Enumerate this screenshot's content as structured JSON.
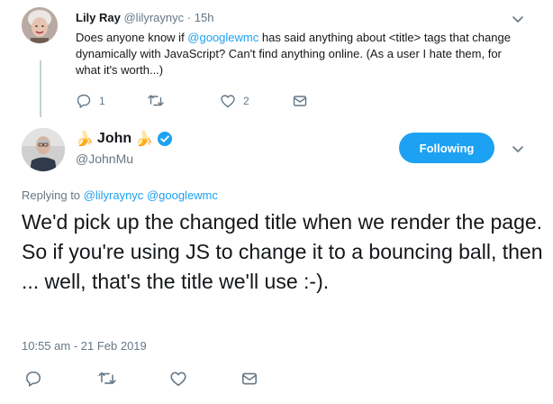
{
  "parent_tweet": {
    "name": "Lily Ray",
    "handle": "@lilyraynyc",
    "separator": "·",
    "time": "15h",
    "body_before_mention": "Does anyone know if ",
    "mention": "@googlewmc",
    "body_after_mention": " has said anything about <title> tags that change dynamically with JavaScript? Can't find anything online. (As a user I hate them, for what it's worth...)",
    "actions": {
      "reply_count": "1",
      "like_count": "2"
    }
  },
  "main_tweet": {
    "name": "John",
    "name_emoji": "🍌",
    "handle": "@JohnMu",
    "follow_label": "Following",
    "replying_prefix": "Replying to ",
    "replying_mention_1": "@lilyraynyc",
    "replying_mention_2": "@googlewmc",
    "body": "We'd pick up the changed title when we render the page. So if you're using JS to change it to a bouncing ball, then ... well, that's the title we'll use :-).",
    "timestamp": "10:55 am - 21 Feb 2019"
  },
  "colors": {
    "accent": "#1da1f2",
    "muted": "#657786",
    "text": "#14171a",
    "thread_line": "#c4cfd6",
    "verified": "#1da1f2"
  },
  "icons": [
    "reply-icon",
    "retweet-icon",
    "like-icon",
    "dm-icon",
    "chevron-down-icon",
    "verified-badge-icon",
    "banana-emoji"
  ]
}
